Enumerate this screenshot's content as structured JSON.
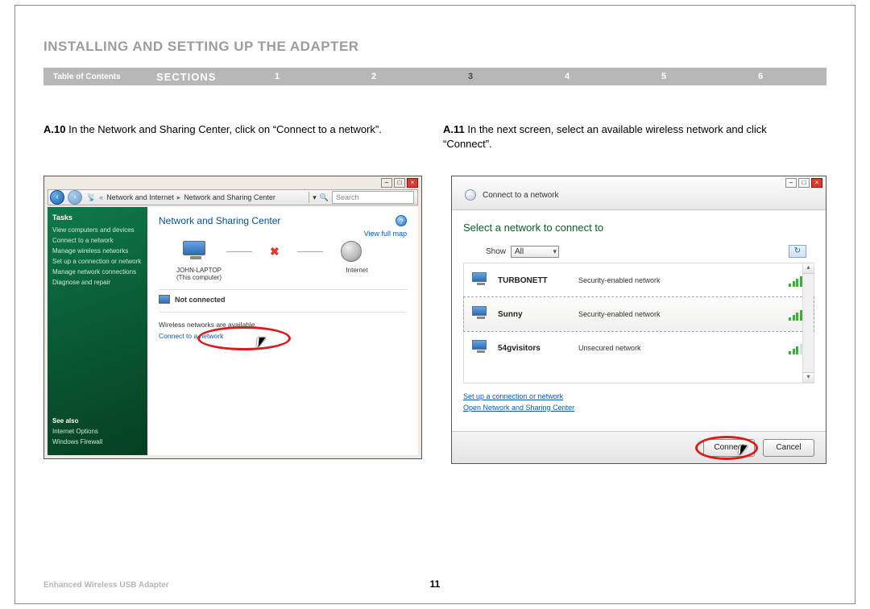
{
  "pageTitle": "INSTALLING AND SETTING UP THE ADAPTER",
  "nav": {
    "toc": "Table of Contents",
    "sections": "SECTIONS",
    "items": [
      "1",
      "2",
      "3",
      "4",
      "5",
      "6"
    ],
    "activeIndex": 2
  },
  "left": {
    "stepNum": "A.10",
    "stepText": " In the Network and Sharing Center, click on “Connect to a network”.",
    "window": {
      "back": "‹",
      "fwd": "›",
      "breadcrumb": [
        "Network and Internet",
        "Network and Sharing Center"
      ],
      "searchPlaceholder": "Search",
      "tasksHeader": "Tasks",
      "tasks": [
        "View computers and devices",
        "Connect to a network",
        "Manage wireless networks",
        "Set up a connection or network",
        "Manage network connections",
        "Diagnose and repair"
      ],
      "seeAlsoHeader": "See also",
      "seeAlso": [
        "Internet Options",
        "Windows Firewall"
      ],
      "contentTitle": "Network and Sharing Center",
      "viewFullMap": "View full map",
      "computerLabel1": "JOHN-LAPTOP",
      "computerLabel2": "(This computer)",
      "internetLabel": "Internet",
      "statusLabel": "Not connected",
      "wirelessMsg": "Wireless networks are available.",
      "connectLink": "Connect to a network"
    }
  },
  "right": {
    "stepNum": "A.11",
    "stepText": " In the next screen, select an available wireless network and click “Connect”.",
    "window": {
      "title": "Connect to a network",
      "prompt": "Select a network to connect to",
      "showLabel": "Show",
      "showValue": "All",
      "refresh": "↻",
      "networks": [
        {
          "name": "TURBONETT",
          "security": "Security-enabled network",
          "selected": false,
          "weak": false
        },
        {
          "name": "Sunny",
          "security": "Security-enabled network",
          "selected": true,
          "weak": false
        },
        {
          "name": "54gvisitors",
          "security": "Unsecured network",
          "selected": false,
          "weak": true
        }
      ],
      "link1": "Set up a connection or network",
      "link2": "Open Network and Sharing Center",
      "connectBtn": "Connect",
      "cancelBtn": "Cancel"
    }
  },
  "footer": {
    "product": "Enhanced Wireless USB Adapter",
    "pageNumber": "11"
  }
}
